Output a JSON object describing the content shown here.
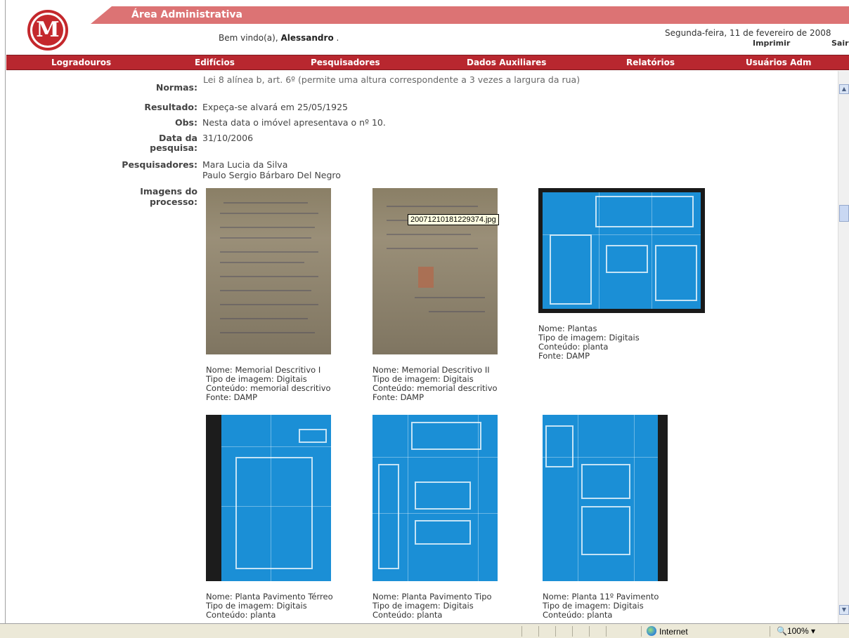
{
  "header": {
    "area_title": "Área Administrativa",
    "logo_letter": "M",
    "welcome_prefix": "Bem vindo(a), ",
    "welcome_user": "Alessandro",
    "welcome_suffix": " .",
    "date": "Segunda-feira, 11 de fevereiro de 2008",
    "print_label": "Imprimir",
    "exit_label": "Sair",
    "accent_color": "#b8272f",
    "bar_color": "#dc7374"
  },
  "nav": {
    "items": [
      "Logradouros",
      "Edifícios",
      "Pesquisadores",
      "Dados Auxiliares",
      "Relatórios",
      "Usuários Adm"
    ]
  },
  "details": {
    "cut_label": "Normas:",
    "cut_text": "Lei 8 alínea b, art. 6º (permite uma altura correspondente a 3 vezes a largura da rua)",
    "resultado_label": "Resultado:",
    "resultado_value": "Expeça-se alvará em 25/05/1925",
    "obs_label": "Obs:",
    "obs_value": "Nesta data o imóvel apresentava o nº 10.",
    "data_label_1": "Data da",
    "data_label_2": "pesquisa:",
    "data_value": "31/10/2006",
    "pesquisadores_label": "Pesquisadores:",
    "pesquisadores": [
      "Mara Lucia da Silva",
      "Paulo Sergio Bárbaro Del Negro"
    ],
    "imagens_label_1": "Imagens do",
    "imagens_label_2": "processo:"
  },
  "images": [
    {
      "nome": "Nome: Memorial Descritivo I",
      "tipo": "Tipo de imagem: Digitais",
      "conteudo": "Conteúdo: memorial descritivo",
      "fonte": "Fonte: DAMP"
    },
    {
      "nome": "Nome: Memorial Descritivo II",
      "tipo": "Tipo de imagem: Digitais",
      "conteudo": "Conteúdo: memorial descritivo",
      "fonte": "Fonte: DAMP"
    },
    {
      "nome": "Nome: Plantas",
      "tipo": "Tipo de imagem: Digitais",
      "conteudo": "Conteúdo: planta",
      "fonte": "Fonte: DAMP"
    },
    {
      "nome": "Nome: Planta Pavimento Térreo",
      "tipo": "Tipo de imagem: Digitais",
      "conteudo": "Conteúdo: planta"
    },
    {
      "nome": "Nome: Planta Pavimento Tipo",
      "tipo": "Tipo de imagem: Digitais",
      "conteudo": "Conteúdo: planta"
    },
    {
      "nome": "Nome: Planta 11º Pavimento",
      "tipo": "Tipo de imagem: Digitais",
      "conteudo": "Conteúdo: planta"
    }
  ],
  "tooltip": "20071210181229374.jpg",
  "status": {
    "zone": "Internet",
    "zoom": "100%"
  }
}
